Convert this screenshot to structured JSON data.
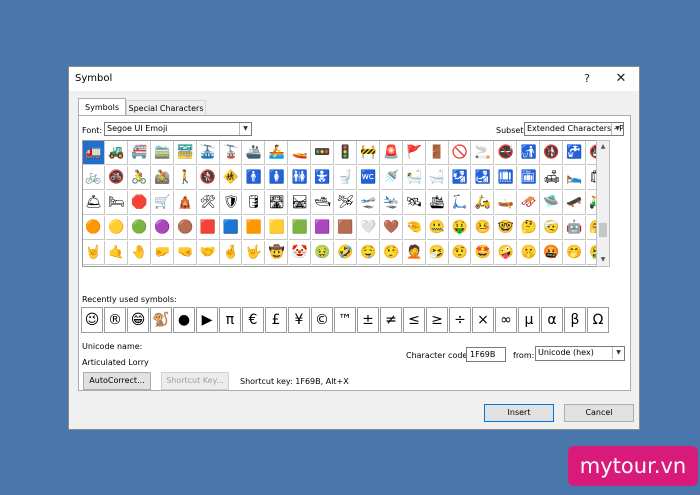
{
  "dialog": {
    "title": "Symbol",
    "help": "?",
    "close": "✕"
  },
  "tabs": [
    {
      "label": "Symbols"
    },
    {
      "label": "Special Characters"
    }
  ],
  "font": {
    "label": "Font:",
    "value": "Segoe UI Emoji"
  },
  "subset": {
    "label": "Subset:",
    "value": "Extended Characters - P"
  },
  "grid_rows": [
    [
      "🚛",
      "🚜",
      "🚝",
      "🚞",
      "🚟",
      "🚠",
      "🚡",
      "🚢",
      "🚣",
      "🚤",
      "🚥",
      "🚦",
      "🚧",
      "🚨",
      "🚩",
      "🚪",
      "🚫",
      "🚬",
      "🚭",
      "🚮",
      "🚯",
      "🚰",
      "🚱"
    ],
    [
      "🚲",
      "🚳",
      "🚴",
      "🚵",
      "🚶",
      "🚷",
      "🚸",
      "🚹",
      "🚺",
      "🚻",
      "🚼",
      "🚽",
      "🚾",
      "🚿",
      "🛀",
      "🛁",
      "🛂",
      "🛃",
      "🛄",
      "🛅",
      "🛋",
      "🛌",
      "🛍"
    ],
    [
      "🛎",
      "🛏",
      "🛑",
      "🛒",
      "🛕",
      "🛠",
      "🛡",
      "🛢",
      "🛣",
      "🛤",
      "🛥",
      "🛩",
      "🛫",
      "🛬",
      "🛰",
      "🛳",
      "🛴",
      "🛵",
      "🛶",
      "🛷",
      "🛸",
      "🛹",
      "🛺"
    ],
    [
      "🟠",
      "🟡",
      "🟢",
      "🟣",
      "🟤",
      "🟥",
      "🟦",
      "🟧",
      "🟨",
      "🟩",
      "🟪",
      "🟫",
      "🤍",
      "🤎",
      "🤏",
      "🤐",
      "🤑",
      "🤒",
      "🤓",
      "🤔",
      "🤕",
      "🤖",
      "🤗"
    ],
    [
      "🤘",
      "🤙",
      "🤚",
      "🤛",
      "🤜",
      "🤝",
      "🤞",
      "🤟",
      "🤠",
      "🤡",
      "🤢",
      "🤣",
      "🤤",
      "🤥",
      "🤦",
      "🤧",
      "🤨",
      "🤩",
      "🤪",
      "🤫",
      "🤬",
      "🤭",
      "🤮"
    ]
  ],
  "recent": {
    "label": "Recently used symbols:",
    "symbols": [
      "😉",
      "®",
      "😁",
      "🐒",
      "●",
      "▶",
      "π",
      "€",
      "£",
      "¥",
      "©",
      "™",
      "±",
      "≠",
      "≤",
      "≥",
      "÷",
      "×",
      "∞",
      "µ",
      "α",
      "β",
      "Ω"
    ]
  },
  "unicode": {
    "name_label": "Unicode name:",
    "name_value": "Articulated Lorry",
    "code_label": "Character code:",
    "code_value": "1F69B",
    "from_label": "from:",
    "from_value": "Unicode (hex)"
  },
  "buttons": {
    "autocorrect": "AutoCorrect...",
    "shortcut_key": "Shortcut Key...",
    "shortcut_text": "Shortcut key: 1F69B, Alt+X",
    "insert": "Insert",
    "cancel": "Cancel"
  },
  "watermark": "mytour.vn"
}
